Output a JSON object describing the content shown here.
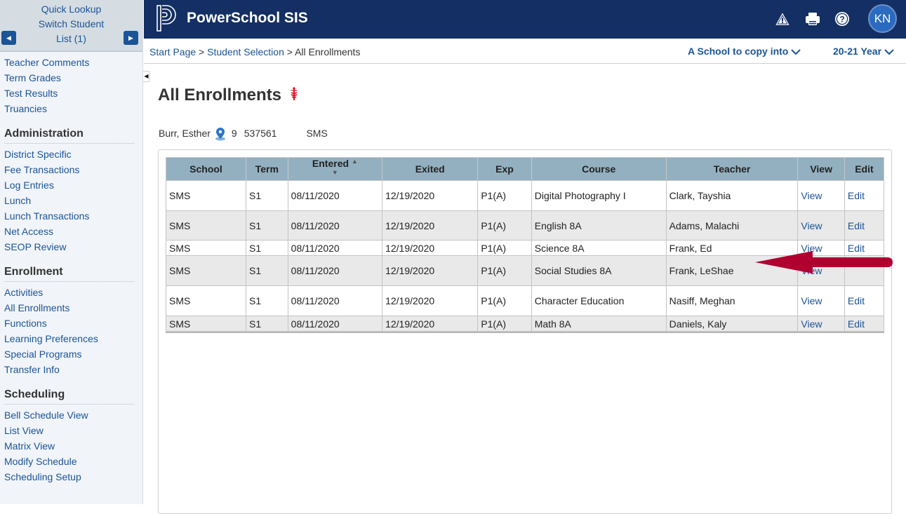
{
  "sidebar": {
    "student_nav": {
      "quick_lookup": "Quick Lookup",
      "switch_student": "Switch Student",
      "list": "List (1)",
      "prev_icon": "caret-left-icon",
      "next_icon": "caret-right-icon"
    },
    "top_items": [
      "Teacher Comments",
      "Term Grades",
      "Test Results",
      "Truancies"
    ],
    "sections": [
      {
        "heading": "Administration",
        "items": [
          "District Specific",
          "Fee Transactions",
          "Log Entries",
          "Lunch",
          "Lunch Transactions",
          "Net Access",
          "SEOP Review"
        ]
      },
      {
        "heading": "Enrollment",
        "items": [
          "Activities",
          "All Enrollments",
          "Functions",
          "Learning Preferences",
          "Special Programs",
          "Transfer Info"
        ]
      },
      {
        "heading": "Scheduling",
        "items": [
          "Bell Schedule View",
          "List View",
          "Matrix View",
          "Modify Schedule",
          "Scheduling Setup"
        ]
      }
    ]
  },
  "header": {
    "brand": "PowerSchool SIS",
    "avatar_initials": "KN",
    "icons": [
      "warning-icon",
      "print-icon",
      "help-icon"
    ]
  },
  "breadcrumb": {
    "items": [
      "Start Page",
      "Student Selection",
      "All Enrollments"
    ],
    "separator": ">"
  },
  "dropdowns": {
    "school": "A School to copy into",
    "year": "20-21 Year"
  },
  "page": {
    "title": "All Enrollments",
    "title_icon": "caduceus-icon"
  },
  "student": {
    "name": "Burr, Esther",
    "grade": "9",
    "id": "537561",
    "school": "SMS"
  },
  "table": {
    "headers": [
      "School",
      "Term",
      "Entered",
      "Exited",
      "Exp",
      "Course",
      "Teacher",
      "View",
      "Edit"
    ],
    "rows": [
      {
        "school": "SMS",
        "term": "S1",
        "entered": "08/11/2020",
        "exited": "12/19/2020",
        "exp": "P1(A)",
        "course": "Digital Photography I",
        "teacher": "Clark, Tayshia",
        "view": "View",
        "edit": "Edit"
      },
      {
        "school": "SMS",
        "term": "S1",
        "entered": "08/11/2020",
        "exited": "12/19/2020",
        "exp": "P1(A)",
        "course": "English 8A",
        "teacher": "Adams, Malachi",
        "view": "View",
        "edit": "Edit"
      },
      {
        "school": "SMS",
        "term": "S1",
        "entered": "08/11/2020",
        "exited": "12/19/2020",
        "exp": "P1(A)",
        "course": "Science 8A",
        "teacher": "Frank, Ed",
        "view": "View",
        "edit": "Edit"
      },
      {
        "school": "SMS",
        "term": "S1",
        "entered": "08/11/2020",
        "exited": "12/19/2020",
        "exp": "P1(A)",
        "course": "Social Studies 8A",
        "teacher": "Frank, LeShae",
        "view": "View",
        "edit": ""
      },
      {
        "school": "SMS",
        "term": "S1",
        "entered": "08/11/2020",
        "exited": "12/19/2020",
        "exp": "P1(A)",
        "course": "Character Education",
        "teacher": "Nasiff, Meghan",
        "view": "View",
        "edit": "Edit"
      },
      {
        "school": "SMS",
        "term": "S1",
        "entered": "08/11/2020",
        "exited": "12/19/2020",
        "exp": "P1(A)",
        "course": "Math 8A",
        "teacher": "Daniels, Kaly",
        "view": "View",
        "edit": "Edit"
      }
    ]
  },
  "colors": {
    "header_bg": "#132f63",
    "link": "#1b5497",
    "table_header_bg": "#93b0c1",
    "annotation_arrow": "#b00030",
    "avatar_bg": "#2a6bc1"
  }
}
